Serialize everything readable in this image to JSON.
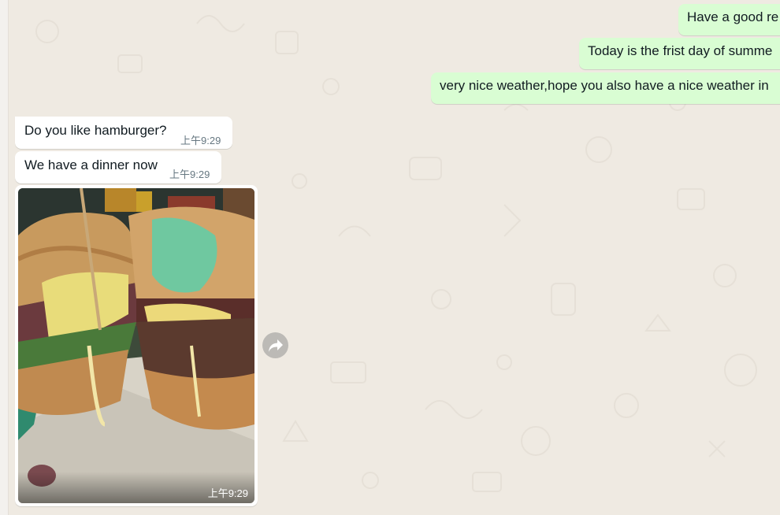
{
  "messages": {
    "outgoing": [
      {
        "text": "Have a good re"
      },
      {
        "text": "Today is the frist day of summe"
      },
      {
        "text": "very nice weather,hope you also have a nice weather in"
      }
    ],
    "incoming": [
      {
        "text": "Do you like hamburger?",
        "time": "上午9:29"
      },
      {
        "text": "We have a dinner now",
        "time": "上午9:29"
      }
    ],
    "image": {
      "time": "上午9:29",
      "description_icon": "hamburger-photo"
    }
  },
  "icons": {
    "forward": "forward-arrow-icon"
  },
  "colors": {
    "chat_background": "#efeae2",
    "outgoing_bubble": "#d9fdd3",
    "incoming_bubble": "#ffffff",
    "timestamp": "#667781"
  }
}
